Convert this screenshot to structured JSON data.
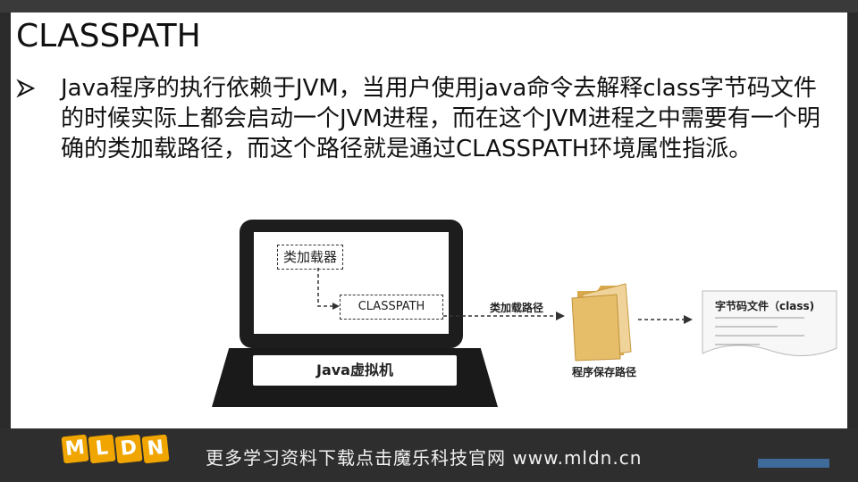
{
  "slide": {
    "title": "CLASSPATH",
    "bullet": "Java程序的执行依赖于JVM，当用户使用java命令去解释class字节码文件的时候实际上都会启动一个JVM进程，而在这个JVM进程之中需要有一个明确的类加载路径，而这个路径就是通过CLASSPATH环境属性指派。"
  },
  "diagram": {
    "loader_label": "类加载器",
    "classpath_label": "CLASSPATH",
    "jvm_label": "Java虚拟机",
    "arrow_label": "类加载路径",
    "folder_label": "程序保存路径",
    "doc_label": "字节码文件（class)"
  },
  "footer": {
    "logo_letters": [
      "M",
      "L",
      "D",
      "N"
    ],
    "text": "更多学习资料下载点击魔乐科技官网 www.mldn.cn"
  }
}
